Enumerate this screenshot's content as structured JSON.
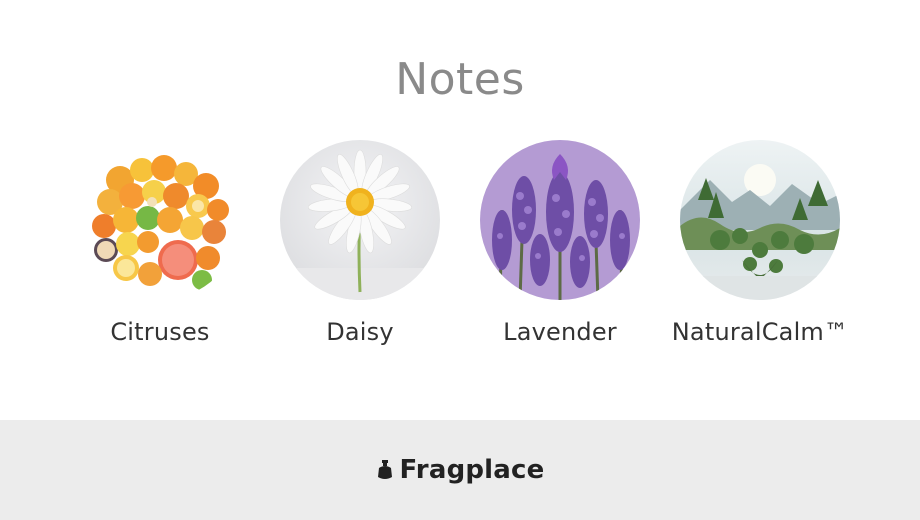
{
  "page": {
    "title": "Notes"
  },
  "notes": [
    {
      "label": "Citruses",
      "image": "citrus-fruits-image"
    },
    {
      "label": "Daisy",
      "image": "daisy-flower-image"
    },
    {
      "label": "Lavender",
      "image": "lavender-flowers-image"
    },
    {
      "label": "NaturalCalm™",
      "image": "nature-landscape-image"
    }
  ],
  "footer": {
    "brand": "Fragplace",
    "brand_icon": "fragplace-logo-icon",
    "background": "#ececec"
  }
}
